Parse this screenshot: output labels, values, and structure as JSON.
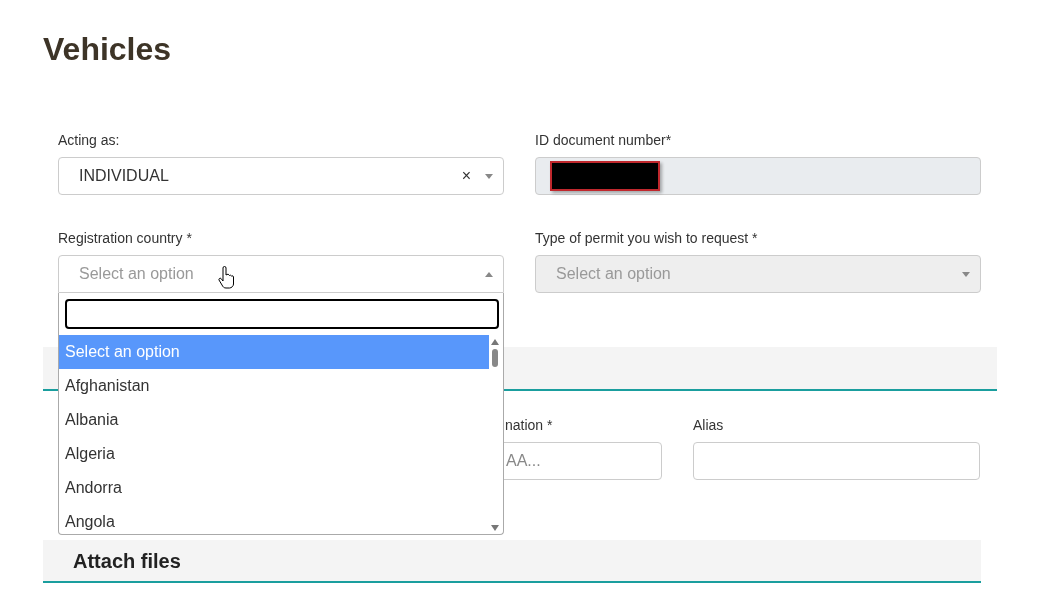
{
  "page_title": "Vehicles",
  "fields": [
    {
      "label": "Acting as:",
      "kind": "select",
      "value": "INDIVIDUAL",
      "clear_symbol": "×",
      "open": false,
      "disabled": false
    },
    {
      "label": "ID document number*",
      "kind": "redacted",
      "disabled": true
    },
    {
      "label": "Registration country *",
      "kind": "select",
      "placeholder": "Select an option",
      "open": true,
      "disabled": false
    },
    {
      "label": "Type of permit you wish to request *",
      "kind": "select",
      "placeholder": "Select an option",
      "open": false,
      "disabled": true
    }
  ],
  "dropdown": {
    "options": [
      {
        "label": "Select an option",
        "selected": true
      },
      {
        "label": "Afghanistan",
        "selected": false
      },
      {
        "label": "Albania",
        "selected": false
      },
      {
        "label": "Algeria",
        "selected": false
      },
      {
        "label": "Andorra",
        "selected": false
      },
      {
        "label": "Angola",
        "selected": false
      }
    ]
  },
  "vehicle_fields": [
    {
      "label": "nation *",
      "placeholder": "AA..."
    },
    {
      "label": "Alias"
    }
  ],
  "attach_section": {
    "title": "Attach files"
  }
}
